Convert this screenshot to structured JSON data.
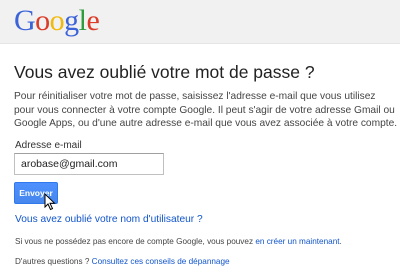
{
  "header": {
    "logo_letters": [
      {
        "char": "G",
        "color": "#3c64d8"
      },
      {
        "char": "o",
        "color": "#db3b28"
      },
      {
        "char": "o",
        "color": "#f1b90c"
      },
      {
        "char": "g",
        "color": "#3c64d8"
      },
      {
        "char": "l",
        "color": "#2f9d3e"
      },
      {
        "char": "e",
        "color": "#db3b28"
      }
    ]
  },
  "main": {
    "title": "Vous avez oublié votre mot de passe ?",
    "description": "Pour réinitialiser votre mot de passe, saisissez l'adresse e-mail que vous utilisez pour vous connecter à votre compte Google. Il peut s'agir de votre adresse Gmail ou Google Apps, ou d'une autre adresse e-mail que vous avez associée à votre compte.",
    "email_label": "Adresse e-mail",
    "email_value": "arobase@gmail.com",
    "submit_label": "Envoyer",
    "forgot_username_link": "Vous avez oublié votre nom d'utilisateur ?",
    "no_account_text": "Si vous ne possédez pas encore de compte Google, vous pouvez ",
    "no_account_link": "en créer un maintenant",
    "no_account_end": ".",
    "questions_text": "D'autres questions ? ",
    "questions_link": "Consultez ces conseils de dépannage"
  },
  "colors": {
    "link": "#1155cc",
    "button": "#4d90fe",
    "header_bg": "#f1f1f1"
  }
}
